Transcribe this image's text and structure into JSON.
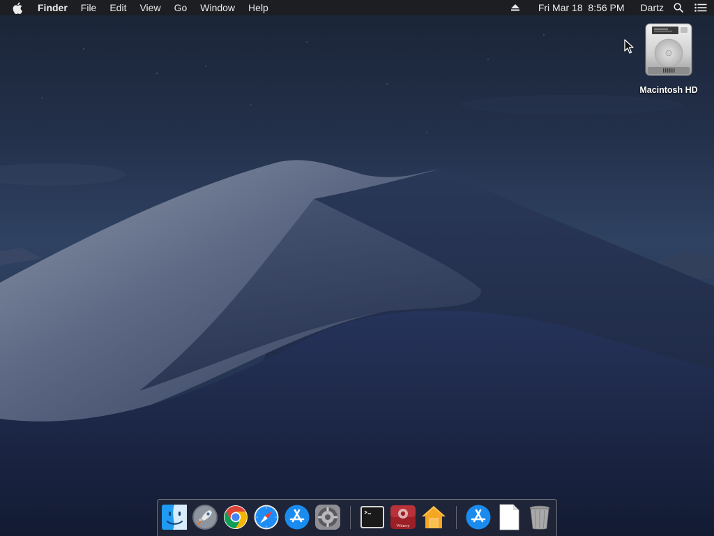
{
  "menubar": {
    "app_name": "Finder",
    "menus": [
      "File",
      "Edit",
      "View",
      "Go",
      "Window",
      "Help"
    ],
    "datetime": "Fri Mar 18  8:56 PM",
    "user": "Dartz",
    "icons": [
      "apple-logo-icon",
      "eject-icon",
      "spotlight-search-icon",
      "notification-center-icon"
    ]
  },
  "desktop": {
    "items": [
      {
        "label": "Macintosh HD",
        "icon": "hard-drive-icon"
      }
    ]
  },
  "dock": {
    "apps": [
      {
        "name": "Finder",
        "icon": "finder-icon",
        "running": true
      },
      {
        "name": "Launchpad",
        "icon": "launchpad-icon",
        "running": false
      },
      {
        "name": "Google Chrome",
        "icon": "chrome-icon",
        "running": false
      },
      {
        "name": "Safari",
        "icon": "safari-icon",
        "running": false
      },
      {
        "name": "App Store",
        "icon": "app-store-icon",
        "running": false
      },
      {
        "name": "System Preferences",
        "icon": "system-preferences-icon",
        "running": false
      },
      {
        "name": "Terminal",
        "icon": "terminal-icon",
        "running": false
      },
      {
        "name": "Winery",
        "icon": "winery-icon",
        "running": false,
        "icon_text": "Winery"
      },
      {
        "name": "Home",
        "icon": "home-icon",
        "running": false
      }
    ],
    "others": [
      {
        "name": "App Store",
        "icon": "app-store-icon"
      },
      {
        "name": "Document",
        "icon": "document-icon"
      },
      {
        "name": "Trash",
        "icon": "trash-icon"
      }
    ]
  },
  "colors": {
    "menubar_bg": "#1e1e20",
    "wallpaper_sky": "#243350",
    "accent_blue": "#1e8cf5"
  }
}
